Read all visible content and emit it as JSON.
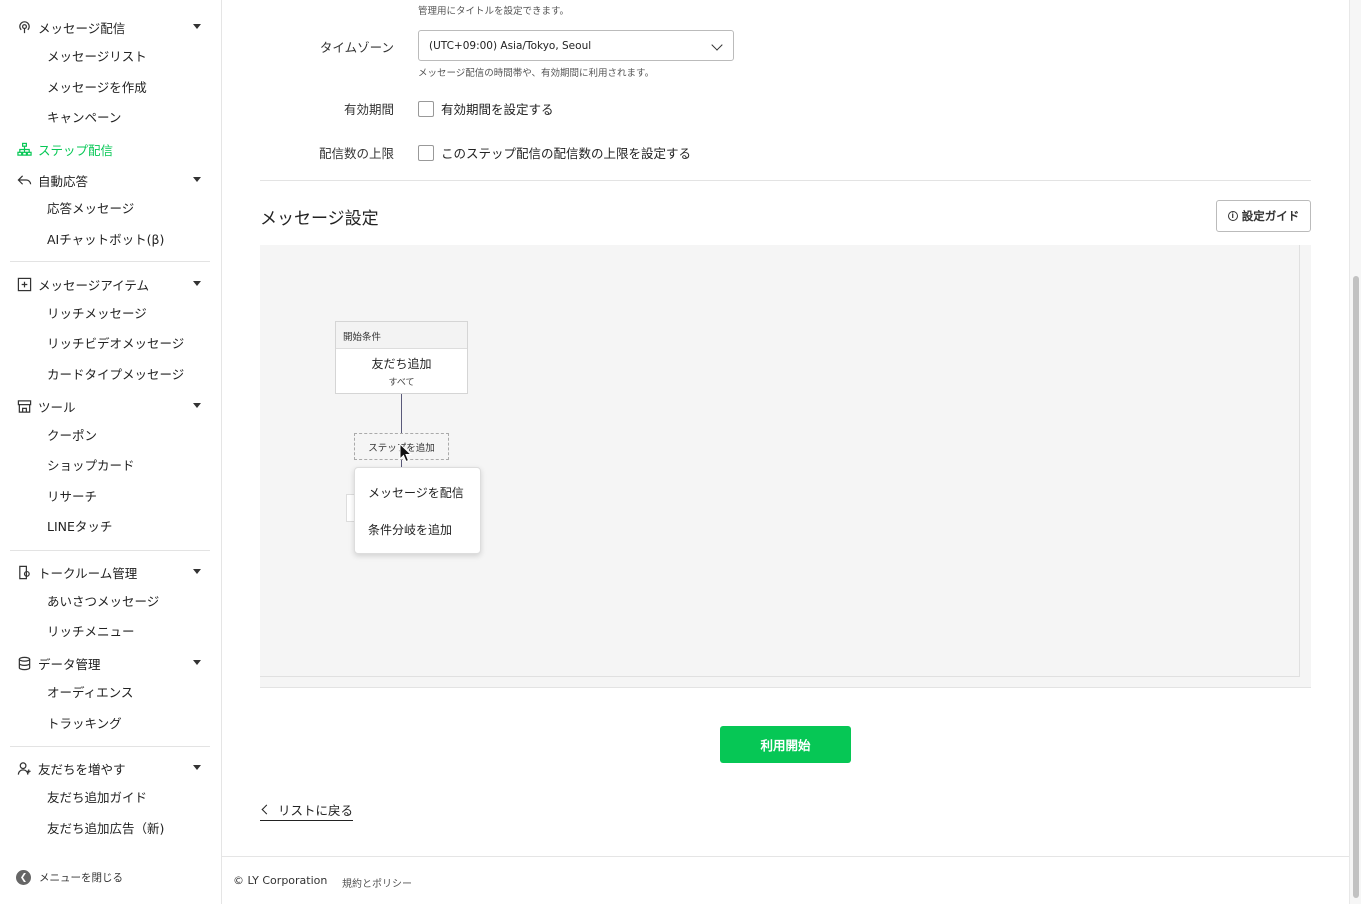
{
  "sidebar": {
    "sections": {
      "message_delivery": "メッセージ配信",
      "step_delivery": "ステップ配信",
      "auto_response": "自動応答",
      "message_items": "メッセージアイテム",
      "tools": "ツール",
      "talk_room": "トークルーム管理",
      "data": "データ管理",
      "friends": "友だちを増やす"
    },
    "items": {
      "message_list": "メッセージリスト",
      "create_message": "メッセージを作成",
      "campaign": "キャンペーン",
      "response_message": "応答メッセージ",
      "ai_chatbot": "AIチャットボット(β)",
      "rich_message": "リッチメッセージ",
      "rich_video": "リッチビデオメッセージ",
      "card_type": "カードタイプメッセージ",
      "coupon": "クーポン",
      "shop_card": "ショップカード",
      "research": "リサーチ",
      "line_touch": "LINEタッチ",
      "greeting": "あいさつメッセージ",
      "rich_menu": "リッチメニュー",
      "audience": "オーディエンス",
      "tracking": "トラッキング",
      "friend_guide": "友だち追加ガイド",
      "friend_ads": "友だち追加広告（新)"
    },
    "close_menu": "メニューを閉じる"
  },
  "form": {
    "title_hint": "管理用にタイトルを設定できます。",
    "timezone_label": "タイムゾーン",
    "timezone_value": "(UTC+09:00) Asia/Tokyo, Seoul",
    "timezone_hint": "メッセージ配信の時間帯や、有効期間に利用されます。",
    "validity_label": "有効期間",
    "validity_checkbox": "有効期間を設定する",
    "limit_label": "配信数の上限",
    "limit_checkbox": "このステップ配信の配信数の上限を設定する"
  },
  "message_settings": {
    "title": "メッセージ設定",
    "guide_button": "設定ガイド",
    "start_card_header": "開始条件",
    "start_card_title": "友だち追加",
    "start_card_sub": "すべて",
    "add_step": "ステップを追加",
    "menu_send_message": "メッセージを配信",
    "menu_add_branch": "条件分岐を追加"
  },
  "actions": {
    "start_button": "利用開始",
    "back_link": "リストに戻る"
  },
  "footer": {
    "copyright": "© LY Corporation",
    "policy": "規約とポリシー"
  },
  "colors": {
    "accent": "#06c755"
  }
}
